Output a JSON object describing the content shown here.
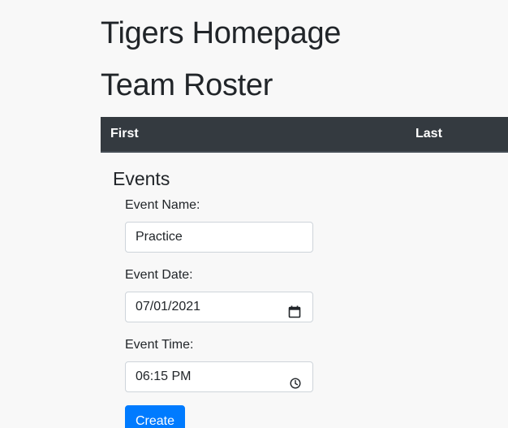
{
  "header": {
    "site_title": "Tigers Homepage"
  },
  "roster": {
    "title": "Team Roster",
    "columns": [
      "First",
      "Last"
    ]
  },
  "events": {
    "heading": "Events",
    "fields": {
      "name": {
        "label": "Event Name:",
        "value": "Practice"
      },
      "date": {
        "label": "Event Date:",
        "value": "07/01/2021",
        "icon": "calendar-icon"
      },
      "time": {
        "label": "Event Time:",
        "value": "06:15 PM",
        "icon": "clock-icon"
      }
    },
    "create_label": "Create"
  },
  "colors": {
    "background": "#f8f8f8",
    "table_header": "#343a40",
    "primary": "#007bff",
    "text": "#212529"
  }
}
